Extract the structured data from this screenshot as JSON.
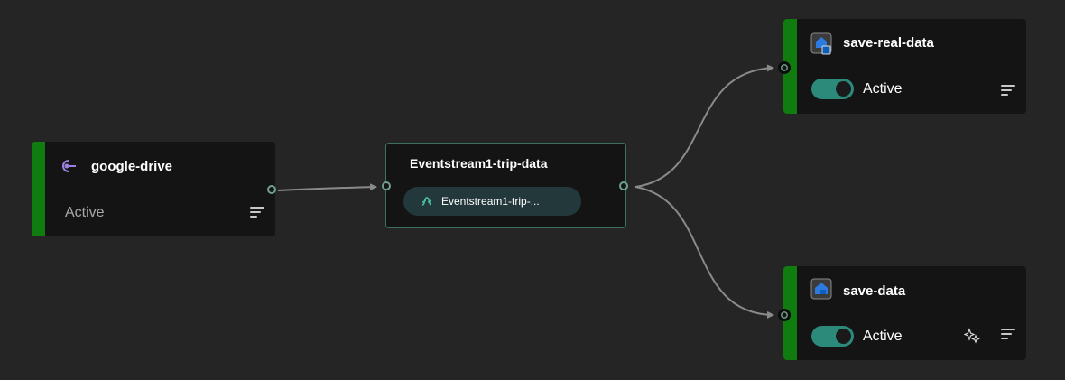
{
  "nodes": {
    "source": {
      "name": "google-drive",
      "status": "Active",
      "icon": "source-connector-icon"
    },
    "stream": {
      "name": "Eventstream1-trip-data",
      "chip_label": "Eventstream1-trip-...",
      "icon": "eventstream-icon"
    },
    "dest1": {
      "name": "save-real-data",
      "status": "Active",
      "icon": "lakehouse-icon",
      "toggle_on": true
    },
    "dest2": {
      "name": "save-data",
      "status": "Active",
      "icon": "lakehouse-icon",
      "toggle_on": true
    }
  },
  "colors": {
    "canvas": "#252525",
    "node_bg": "#141414",
    "active_accent": "#107c10",
    "toggle_on": "#2b8a7a",
    "link": "#8a8a8a",
    "stream_border": "#3f6f5f"
  }
}
